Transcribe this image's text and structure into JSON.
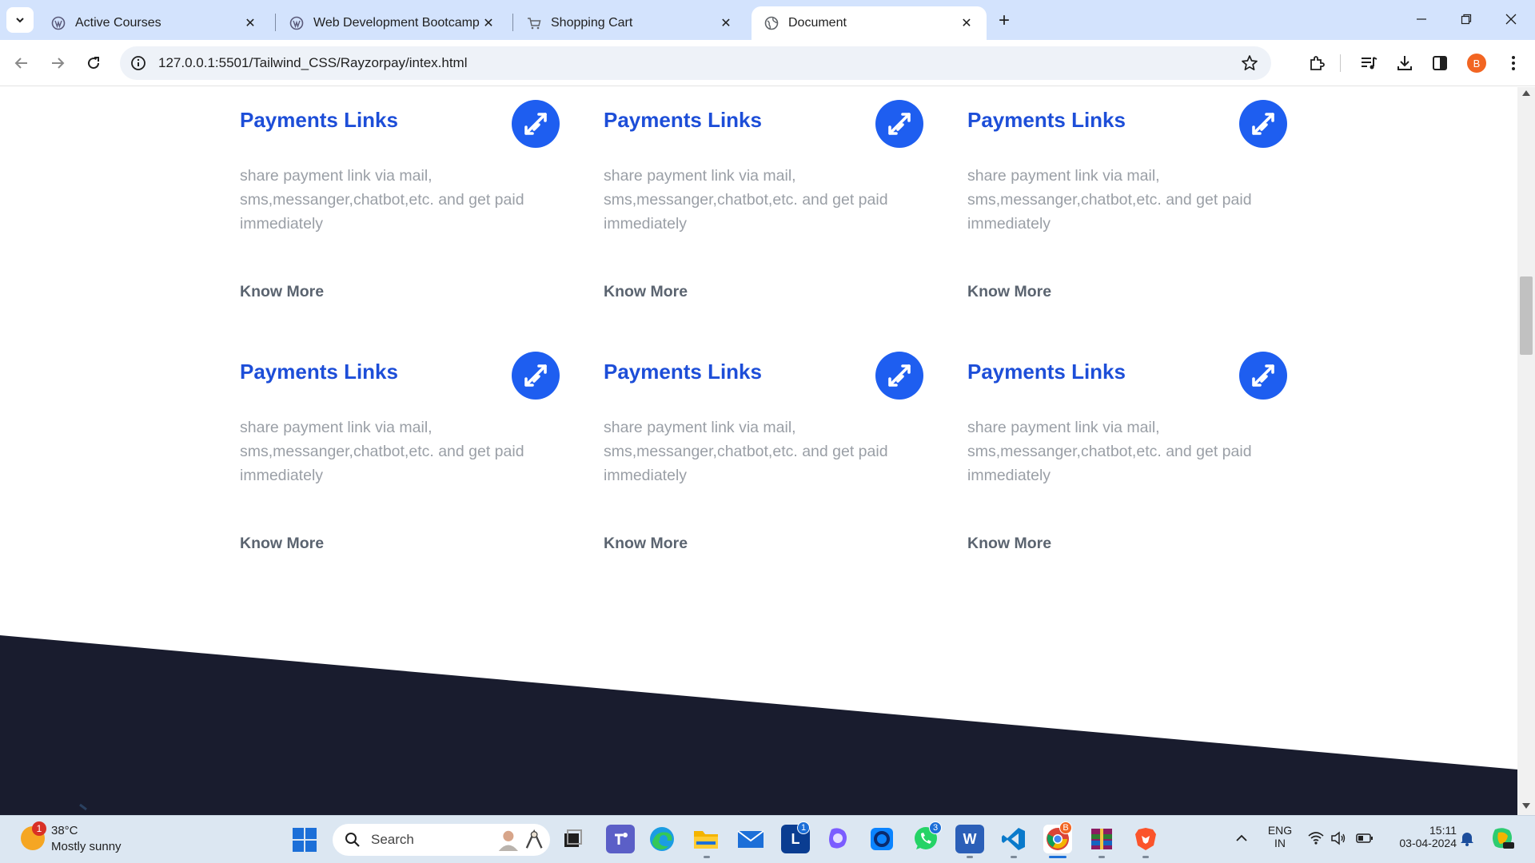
{
  "browser": {
    "tabs": [
      {
        "title": "Active Courses",
        "favicon": "wordpress-like-icon",
        "active": false
      },
      {
        "title": "Web Development Bootcamp [",
        "favicon": "wordpress-like-icon",
        "active": false
      },
      {
        "title": "Shopping Cart",
        "favicon": "cart-icon",
        "active": false
      },
      {
        "title": "Document",
        "favicon": "globe-icon",
        "active": true
      }
    ],
    "close_glyph": "✕",
    "new_tab_glyph": "+",
    "address_bar": {
      "url": "127.0.0.1:5501/Tailwind_CSS/Rayzorpay/intex.html"
    },
    "profile_initial": "B"
  },
  "page": {
    "cards": [
      {
        "title": "Payments Links",
        "description": "share payment link via mail, sms,messanger,chatbot,etc. and get paid immediately",
        "link": "Know More",
        "icon": "payment-link-arrows-icon"
      },
      {
        "title": "Payments Links",
        "description": "share payment link via mail, sms,messanger,chatbot,etc. and get paid immediately",
        "link": "Know More",
        "icon": "payment-link-arrows-icon"
      },
      {
        "title": "Payments Links",
        "description": "share payment link via mail, sms,messanger,chatbot,etc. and get paid immediately",
        "link": "Know More",
        "icon": "payment-link-arrows-icon"
      },
      {
        "title": "Payments Links",
        "description": "share payment link via mail, sms,messanger,chatbot,etc. and get paid immediately",
        "link": "Know More",
        "icon": "payment-link-arrows-icon"
      },
      {
        "title": "Payments Links",
        "description": "share payment link via mail, sms,messanger,chatbot,etc. and get paid immediately",
        "link": "Know More",
        "icon": "payment-link-arrows-icon"
      },
      {
        "title": "Payments Links",
        "description": "share payment link via mail, sms,messanger,chatbot,etc. and get paid immediately",
        "link": "Know More",
        "icon": "payment-link-arrows-icon"
      }
    ],
    "colors": {
      "title": "#1d4ed8",
      "icon_bg": "#1e5ef0",
      "description": "#9a9fa6",
      "link": "#5b6470",
      "footer_bg": "#191c2e"
    }
  },
  "taskbar": {
    "weather": {
      "temp": "38°C",
      "condition": "Mostly sunny",
      "badge": "1"
    },
    "search_placeholder": "Search",
    "apps": [
      {
        "name": "task-view",
        "badge": ""
      },
      {
        "name": "teams",
        "badge": ""
      },
      {
        "name": "edge",
        "badge": ""
      },
      {
        "name": "file-explorer",
        "badge": ""
      },
      {
        "name": "mail",
        "badge": ""
      },
      {
        "name": "linkedin-like",
        "label": "L",
        "badge": "1"
      },
      {
        "name": "copilot",
        "badge": ""
      },
      {
        "name": "cortana-like",
        "badge": ""
      },
      {
        "name": "whatsapp",
        "badge": "3"
      },
      {
        "name": "word",
        "label": "W",
        "badge": ""
      },
      {
        "name": "vscode",
        "badge": ""
      },
      {
        "name": "chrome",
        "badge": "B"
      },
      {
        "name": "winrar",
        "badge": ""
      },
      {
        "name": "brave",
        "badge": ""
      }
    ],
    "language": {
      "line1": "ENG",
      "line2": "IN"
    },
    "clock": {
      "time": "15:11",
      "date": "03-04-2024"
    }
  }
}
